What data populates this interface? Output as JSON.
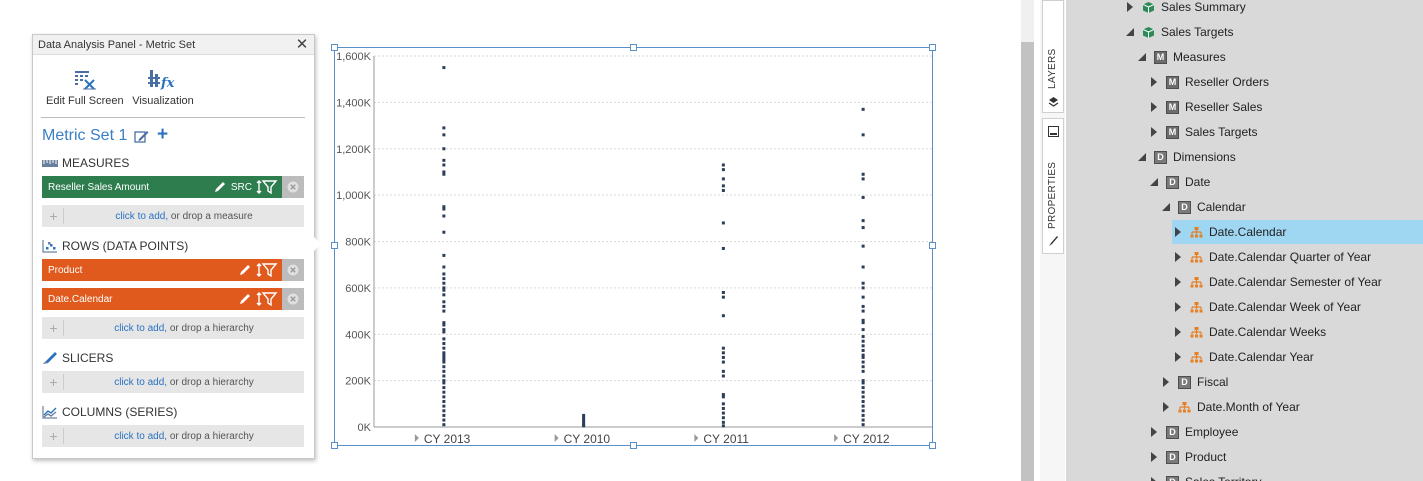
{
  "panel": {
    "title": "Data Analysis Panel - Metric Set",
    "close_glyph": "✕",
    "tools": [
      {
        "label": "Edit Full Screen",
        "icon": "edit-full-screen-icon"
      },
      {
        "label": "Visualization",
        "icon": "visualization-icon"
      }
    ],
    "metric_set_title": "Metric Set 1",
    "add_glyph": "+",
    "sections": {
      "measures": "MEASURES",
      "rows": "ROWS (DATA POINTS)",
      "slicers": "SLICERS",
      "columns": "COLUMNS (SERIES)"
    },
    "measure_pills": [
      {
        "label": "Reseller Sales Amount",
        "src": "SRC",
        "color": "#2e7d4f"
      }
    ],
    "row_pills": [
      {
        "label": "Product",
        "color": "#e05a1e"
      },
      {
        "label": "Date.Calendar",
        "color": "#e05a1e"
      }
    ],
    "dropzones": {
      "link": "click to add,",
      "measure_suffix": " or drop a measure",
      "hierarchy_suffix": " or drop a hierarchy"
    }
  },
  "chart_data": {
    "type": "scatter",
    "categories": [
      "CY 2013",
      "CY 2010",
      "CY 2011",
      "CY 2012"
    ],
    "ylim": [
      0,
      1600000
    ],
    "yticks": [
      {
        "value": 0,
        "label": "0K"
      },
      {
        "value": 200000,
        "label": "200K"
      },
      {
        "value": 400000,
        "label": "400K"
      },
      {
        "value": 600000,
        "label": "600K"
      },
      {
        "value": 800000,
        "label": "800K"
      },
      {
        "value": 1000000,
        "label": "1,000K"
      },
      {
        "value": 1200000,
        "label": "1,200K"
      },
      {
        "value": 1400000,
        "label": "1,400K"
      },
      {
        "value": 1600000,
        "label": "1,600K"
      }
    ],
    "grid": true,
    "point_color": "#2c3e5a",
    "series": [
      {
        "category": "CY 2013",
        "values": [
          1550000,
          1290000,
          1260000,
          1200000,
          1150000,
          1130000,
          1100000,
          1090000,
          950000,
          940000,
          910000,
          840000,
          740000,
          690000,
          660000,
          640000,
          620000,
          600000,
          590000,
          570000,
          540000,
          520000,
          500000,
          450000,
          440000,
          420000,
          410000,
          380000,
          360000,
          340000,
          320000,
          310000,
          300000,
          290000,
          280000,
          260000,
          240000,
          220000,
          200000,
          190000,
          170000,
          150000,
          130000,
          110000,
          90000,
          70000,
          50000,
          30000,
          10000
        ]
      },
      {
        "category": "CY 2010",
        "values": [
          50000,
          40000,
          30000,
          20000,
          10000,
          5000
        ]
      },
      {
        "category": "CY 2011",
        "values": [
          1130000,
          1110000,
          1070000,
          1040000,
          1020000,
          880000,
          770000,
          580000,
          560000,
          480000,
          340000,
          320000,
          300000,
          280000,
          240000,
          220000,
          140000,
          130000,
          100000,
          80000,
          60000,
          40000,
          20000,
          5000
        ]
      },
      {
        "category": "CY 2012",
        "values": [
          1370000,
          1260000,
          1090000,
          1070000,
          990000,
          890000,
          860000,
          780000,
          690000,
          620000,
          600000,
          560000,
          520000,
          500000,
          460000,
          450000,
          420000,
          390000,
          370000,
          350000,
          330000,
          310000,
          300000,
          280000,
          260000,
          240000,
          200000,
          190000,
          170000,
          150000,
          130000,
          110000,
          90000,
          70000,
          50000,
          30000,
          10000
        ]
      }
    ]
  },
  "side_tabs": {
    "layers": "LAYERS",
    "properties": "PROPERTIES"
  },
  "tree": {
    "items": [
      {
        "label": "Sales Summary",
        "type": "cube",
        "expander": "collapsed"
      },
      {
        "label": "Sales Targets",
        "type": "cube",
        "expander": "expanded"
      },
      {
        "label": "Measures",
        "type": "measure",
        "expander": "expanded"
      },
      {
        "label": "Reseller Orders",
        "type": "measure",
        "expander": "collapsed"
      },
      {
        "label": "Reseller Sales",
        "type": "measure",
        "expander": "collapsed"
      },
      {
        "label": "Sales Targets",
        "type": "measure",
        "expander": "collapsed"
      },
      {
        "label": "Dimensions",
        "type": "dimension",
        "expander": "expanded"
      },
      {
        "label": "Date",
        "type": "dimension",
        "expander": "expanded"
      },
      {
        "label": "Calendar",
        "type": "dimension",
        "expander": "expanded"
      },
      {
        "label": "Date.Calendar",
        "type": "hierarchy",
        "expander": "collapsed",
        "selected": true
      },
      {
        "label": "Date.Calendar Quarter of Year",
        "type": "hierarchy",
        "expander": "collapsed"
      },
      {
        "label": "Date.Calendar Semester of Year",
        "type": "hierarchy",
        "expander": "collapsed"
      },
      {
        "label": "Date.Calendar Week of Year",
        "type": "hierarchy",
        "expander": "collapsed"
      },
      {
        "label": "Date.Calendar Weeks",
        "type": "hierarchy",
        "expander": "collapsed"
      },
      {
        "label": "Date.Calendar Year",
        "type": "hierarchy",
        "expander": "collapsed"
      },
      {
        "label": "Fiscal",
        "type": "dimension",
        "expander": "collapsed"
      },
      {
        "label": "Date.Month of Year",
        "type": "hierarchy",
        "expander": "collapsed"
      },
      {
        "label": "Employee",
        "type": "dimension",
        "expander": "collapsed"
      },
      {
        "label": "Product",
        "type": "dimension",
        "expander": "collapsed"
      },
      {
        "label": "Sales Territory",
        "type": "dimension",
        "expander": "collapsed"
      }
    ]
  },
  "colors": {
    "accent_blue": "#3a7fc0",
    "measure_green": "#2e7d4f",
    "row_orange": "#e05a1e",
    "tree_bg": "#d9d9d9",
    "tree_selected": "#9fd6f2",
    "hierarchy_icon": "#e67e22",
    "cube_icon": "#2e8b57"
  }
}
